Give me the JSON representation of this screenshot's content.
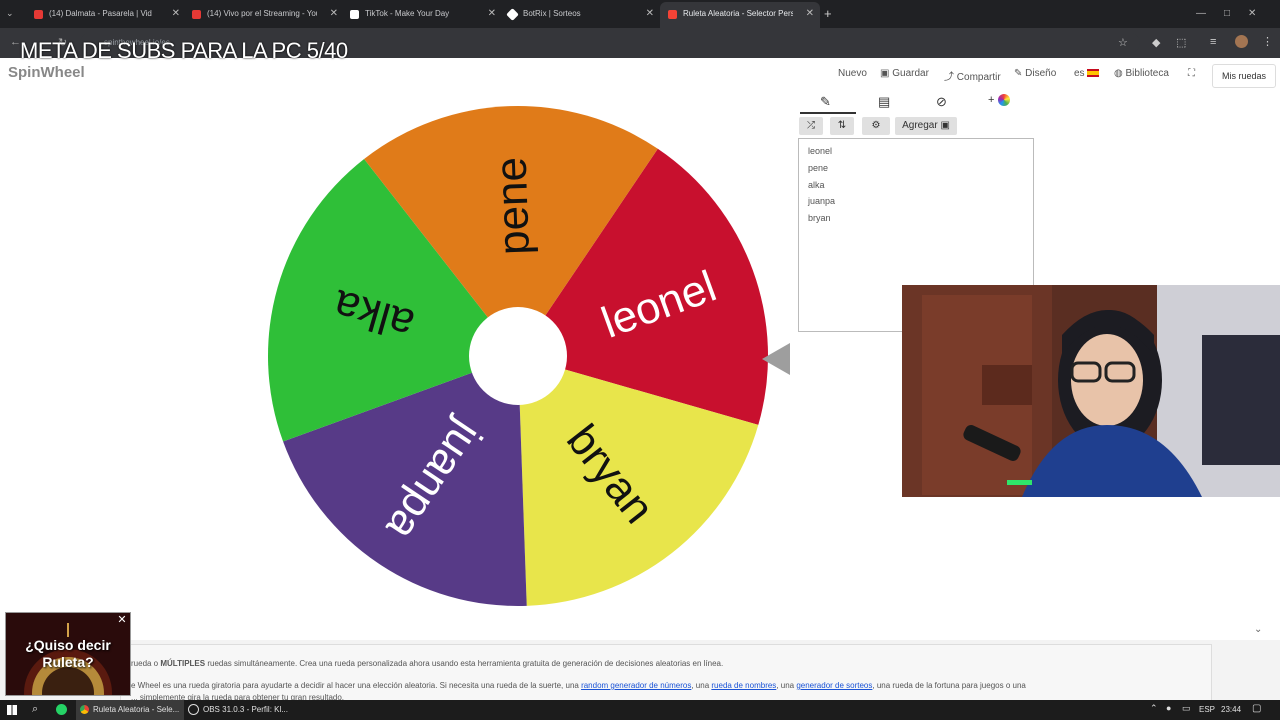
{
  "browser": {
    "tabs": [
      {
        "title": "(14) Dalmata - Pasarela | Vid",
        "favicon_color": "#e53935"
      },
      {
        "title": "(14) Vivo por el Streaming - You",
        "favicon_color": "#e53935"
      },
      {
        "title": "TikTok - Make Your Day",
        "favicon_color": "#ffffff"
      },
      {
        "title": "BotRix | Sorteos",
        "favicon_color": "#ffffff"
      },
      {
        "title": "Ruleta Aleatoria - Selector Pers",
        "favicon_color": "#f44336"
      }
    ],
    "new_tab": "+",
    "close_glyph": "✕",
    "url": "spinthewheel.io/es"
  },
  "overlay_text": "META DE SUBS PARA LA PC 5/40",
  "site": {
    "brand": "SpinWheel",
    "nav": {
      "new": "Nuevo",
      "save": "Guardar",
      "share": "Compartir",
      "design": "Diseño",
      "lang": "es",
      "library": "Biblioteca",
      "my_wheels": "Mis ruedas"
    }
  },
  "wheel": {
    "segments": [
      {
        "label": "leonel",
        "color": "#c8102e"
      },
      {
        "label": "bryan",
        "color": "#e8e54b"
      },
      {
        "label": "juanpa",
        "color": "#573a87"
      },
      {
        "label": "alka",
        "color": "#2fbf38"
      },
      {
        "label": "pene",
        "color": "#e07b19"
      }
    ],
    "pointer_color": "#9e9e9e"
  },
  "editor": {
    "tabs": {
      "edit_icon": "pencil-icon",
      "list_icon": "clipboard-icon",
      "hide_icon": "eye-off-icon",
      "add_color": "+"
    },
    "buttons": {
      "shuffle": "⤮",
      "sort": "⇅",
      "settings": "⚙",
      "add": "Agregar"
    },
    "entries": [
      "leonel",
      "pene",
      "alka",
      "juanpa",
      "bryan"
    ]
  },
  "info": {
    "line1_start": "rueda o ",
    "line1_bold": "MÚLTIPLES",
    "line1_end": " ruedas simultáneamente. Crea una rueda personalizada ahora usando esta herramienta gratuita de generación de decisiones aleatorias en línea.",
    "line2_start": "e Wheel es una rueda giratoria para ayudarte a decidir al hacer una elección aleatoria. Si necesita una rueda de la suerte, una ",
    "link1": "random generador de números",
    "sep1": ", una ",
    "link2": "rueda de nombres",
    "sep2": ", una ",
    "link3": "generador de sorteos",
    "line2_end": ", una rueda de la fortuna para juegos o una",
    "line3": "... simplemente gira la rueda para obtener tu gran resultado."
  },
  "ad": {
    "text": "¿Quiso decir Ruleta?",
    "close": "✕"
  },
  "taskbar": {
    "item1": "Ruleta Aleatoria - Sele...",
    "item2": "OBS 31.0.3 - Perfil: Kl...",
    "lang": "ESP",
    "time": "23:44"
  }
}
